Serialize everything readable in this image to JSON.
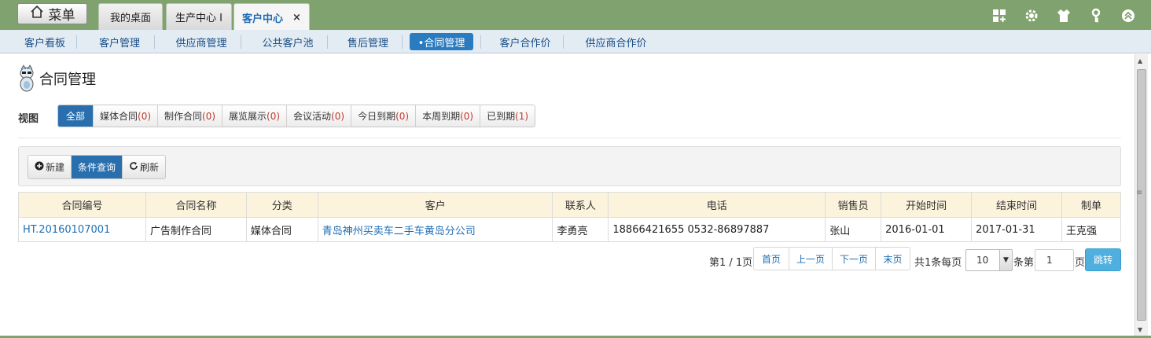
{
  "header": {
    "menu_label": "菜单",
    "tabs": [
      {
        "label": "我的桌面"
      },
      {
        "label": "生产中心 I"
      },
      {
        "label": "客户中心",
        "close": "×"
      }
    ]
  },
  "nav": {
    "items": [
      {
        "label": "客户看板"
      },
      {
        "label": "客户管理"
      },
      {
        "label": "供应商管理"
      },
      {
        "label": "公共客户池"
      },
      {
        "label": "售后管理"
      },
      {
        "label": "•合同管理"
      },
      {
        "label": "客户合作价"
      },
      {
        "label": "供应商合作价"
      }
    ]
  },
  "page": {
    "title": "合同管理",
    "view_label": "视图",
    "views": [
      {
        "label": "全部",
        "count": ""
      },
      {
        "label": "媒体合同 ",
        "count": "(0)"
      },
      {
        "label": "制作合同 ",
        "count": "(0)"
      },
      {
        "label": "展览展示 ",
        "count": "(0)"
      },
      {
        "label": "会议活动 ",
        "count": "(0)"
      },
      {
        "label": "今日到期",
        "count": "(0)"
      },
      {
        "label": "本周到期",
        "count": "(0)"
      },
      {
        "label": "已到期",
        "count": "(1)"
      }
    ]
  },
  "toolbar": {
    "new_label": "新建",
    "query_label": "条件查询",
    "refresh_label": "刷新"
  },
  "table": {
    "columns": [
      "合同编号",
      "合同名称",
      "分类",
      "客户",
      "联系人",
      "电话",
      "销售员",
      "开始时间",
      "结束时间",
      "制单"
    ],
    "rows": [
      [
        "HT.20160107001",
        "广告制作合同",
        "媒体合同",
        "青岛神州买卖车二手车黄岛分公司",
        "李勇亮",
        "18866421655 0532-86897887",
        "张山",
        "2016-01-01",
        "2017-01-31",
        "王克强"
      ]
    ]
  },
  "pager": {
    "page_info": "第1 / 1页",
    "first": "首页",
    "prev": "上一页",
    "next": "下一页",
    "last": "末页",
    "total_text": "共1条每页",
    "page_size": "10",
    "items_label": "条第",
    "page_input": "1",
    "page_suffix": "页",
    "go_label": "跳转"
  },
  "colors": {
    "topbar": "#7fa26e",
    "primary": "#2a6fad",
    "link": "#1f6fb5",
    "header_row": "#fbf3dc",
    "go_button": "#4fb0e0"
  }
}
